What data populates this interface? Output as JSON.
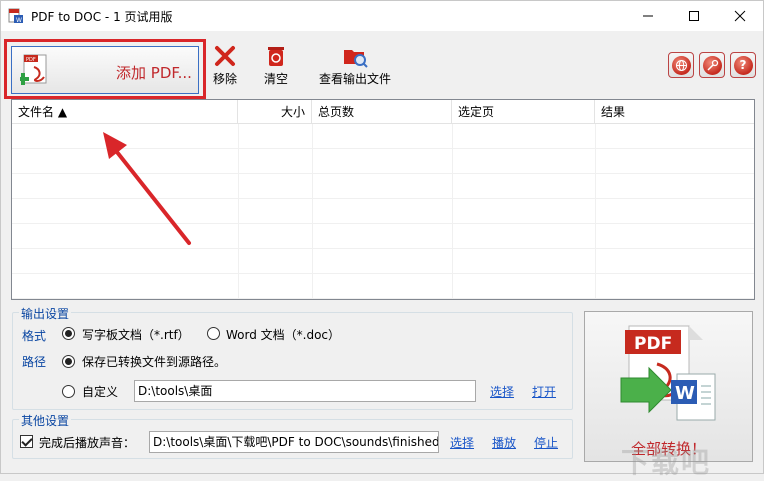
{
  "window": {
    "title": "PDF to DOC - 1 页试用版",
    "controls": {
      "minimize": "minimize",
      "maximize": "maximize",
      "close": "close"
    }
  },
  "toolbar": {
    "add_pdf_label": "添加 PDF...",
    "remove_label": "移除",
    "clear_label": "清空",
    "view_output_label": "查看输出文件"
  },
  "table": {
    "columns": [
      "文件名 ▲",
      "大小",
      "总页数",
      "选定页",
      "结果"
    ],
    "rows": []
  },
  "output_settings": {
    "legend": "输出设置",
    "format_label": "格式",
    "format_options": [
      "写字板文档（*.rtf）",
      "Word 文档（*.doc）"
    ],
    "format_selected": "写字板文档（*.rtf）",
    "path_label": "路径",
    "path_options": [
      "保存已转换文件到源路径。",
      "自定义"
    ],
    "path_selected": "保存已转换文件到源路径。",
    "custom_path_value": "D:\\tools\\桌面",
    "choose_link": "选择",
    "open_link": "打开"
  },
  "other_settings": {
    "legend": "其他设置",
    "play_sound_label": "完成后播放声音：",
    "play_sound_checked": true,
    "sound_path_value": "D:\\tools\\桌面\\下载吧\\PDF to DOC\\sounds\\finished.w",
    "choose_link": "选择",
    "play_link": "播放",
    "stop_link": "停止"
  },
  "convert": {
    "label": "全部转换！",
    "icon_text": "PDF",
    "word_letter": "W"
  },
  "watermark": {
    "text": "下载吧"
  },
  "colors": {
    "accent_red": "#c0282c",
    "highlight_border": "#d9262a",
    "legend_blue": "#0a46a2",
    "link_blue": "#1a56c8"
  }
}
